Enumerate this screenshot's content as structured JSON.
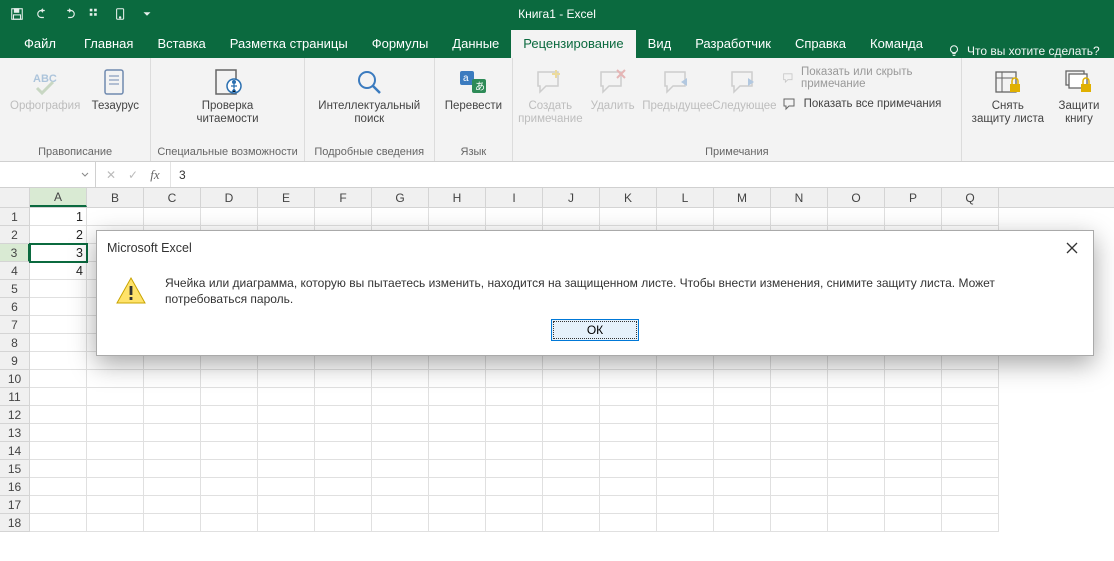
{
  "titlebar": {
    "doc_title": "Книга1 - Excel"
  },
  "tabs": {
    "file": "Файл",
    "items": [
      "Главная",
      "Вставка",
      "Разметка страницы",
      "Формулы",
      "Данные",
      "Рецензирование",
      "Вид",
      "Разработчик",
      "Справка",
      "Команда"
    ],
    "active_index": 5,
    "tell_me": "Что вы хотите сделать?"
  },
  "ribbon": {
    "groups": [
      {
        "label": "Правописание",
        "buttons": [
          {
            "label": "Орфография",
            "icon": "spellcheck-icon",
            "disabled": true
          },
          {
            "label": "Тезаурус",
            "icon": "thesaurus-icon",
            "disabled": false
          }
        ]
      },
      {
        "label": "Специальные возможности",
        "buttons": [
          {
            "label": "Проверка\nчитаемости",
            "icon": "accessibility-icon",
            "disabled": false
          }
        ]
      },
      {
        "label": "Подробные сведения",
        "buttons": [
          {
            "label": "Интеллектуальный\nпоиск",
            "icon": "smart-lookup-icon",
            "disabled": false
          }
        ]
      },
      {
        "label": "Язык",
        "buttons": [
          {
            "label": "Перевести",
            "icon": "translate-icon",
            "disabled": false
          }
        ]
      },
      {
        "label": "Примечания",
        "buttons": [
          {
            "label": "Создать\nпримечание",
            "icon": "new-comment-icon",
            "disabled": true
          },
          {
            "label": "Удалить",
            "icon": "delete-comment-icon",
            "disabled": true
          },
          {
            "label": "Предыдущее",
            "icon": "prev-comment-icon",
            "disabled": true
          },
          {
            "label": "Следующее",
            "icon": "next-comment-icon",
            "disabled": true
          }
        ],
        "side_buttons": [
          {
            "label": "Показать или скрыть примечание",
            "icon": "show-hide-comment-icon",
            "disabled": true
          },
          {
            "label": "Показать все примечания",
            "icon": "show-all-comments-icon",
            "disabled": false
          }
        ]
      },
      {
        "label": "",
        "buttons": [
          {
            "label": "Снять\nзащиту листа",
            "icon": "unprotect-sheet-icon",
            "disabled": false
          },
          {
            "label": "Защити\nкнигу",
            "icon": "protect-workbook-icon",
            "disabled": false
          }
        ]
      }
    ]
  },
  "formula_bar": {
    "name_box": "",
    "cancel": "✕",
    "enter": "✓",
    "fx": "fx",
    "formula_value": "3"
  },
  "grid": {
    "columns": [
      "A",
      "B",
      "C",
      "D",
      "E",
      "F",
      "G",
      "H",
      "I",
      "J",
      "K",
      "L",
      "M",
      "N",
      "O",
      "P",
      "Q"
    ],
    "row_count": 18,
    "selected_col_index": 0,
    "selected_row_index": 2,
    "cells": {
      "A1": "1",
      "A2": "2",
      "A3": "3",
      "A4": "4"
    }
  },
  "dialog": {
    "title": "Microsoft Excel",
    "message": "Ячейка или диаграмма, которую вы пытаетесь изменить, находится на защищенном листе. Чтобы внести изменения, снимите защиту листа. Может потребоваться пароль.",
    "ok": "ОК"
  }
}
